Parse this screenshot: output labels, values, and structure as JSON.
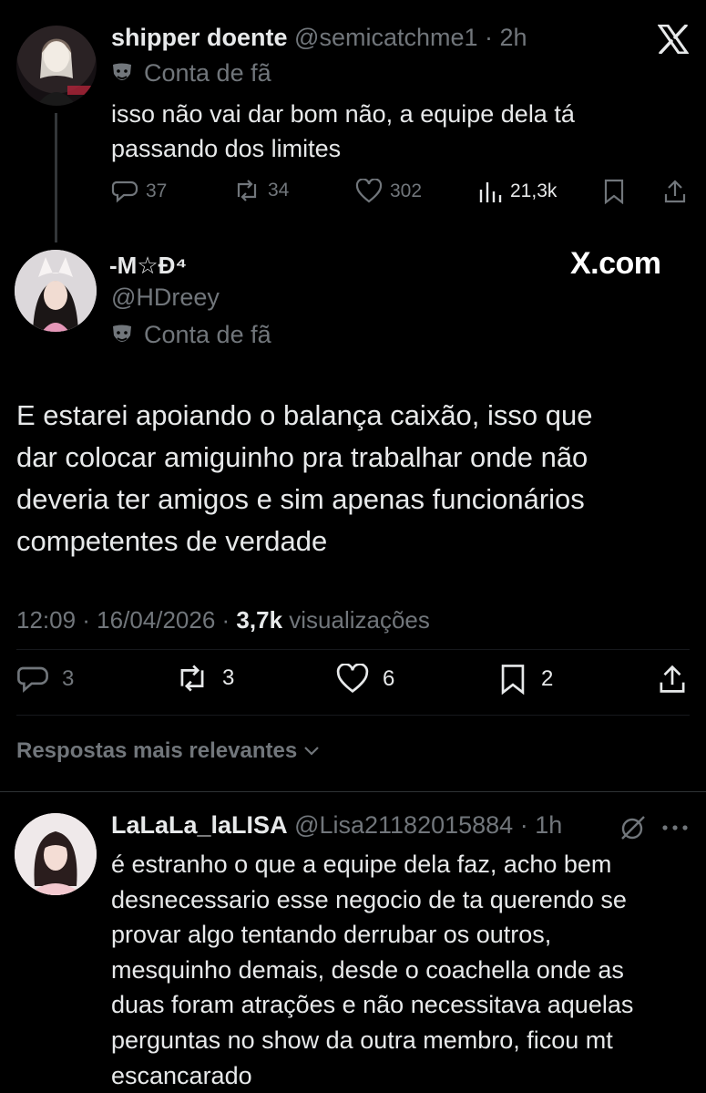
{
  "parent_tweet": {
    "display_name": "shipper doente",
    "handle": "@semicatchme1",
    "time": "· 2h",
    "label": "Conta de fã",
    "text": "isso não vai dar bom não, a equipe dela tá\npassando dos limites",
    "replies": "37",
    "reposts": "34",
    "likes": "302",
    "views": "21,3k"
  },
  "main_tweet": {
    "display_name": "-M☆Ð⁴",
    "handle": "@HDreey",
    "label": "Conta de fã",
    "watermark": "X.com",
    "text": "E estarei apoiando o balança caixão, isso que\ndar colocar amiguinho pra trabalhar onde não\ndeveria ter amigos e sim apenas funcionários\ncompetentes de verdade",
    "timestamp": "12:09 · 16/04/2026 ·",
    "views_count": "3,7k",
    "views_label": "visualizações",
    "replies": "3",
    "reposts": "3",
    "likes": "6",
    "bookmarks": "2"
  },
  "sort": {
    "label": "Respostas mais relevantes"
  },
  "reply_tweet": {
    "display_name": "LaLaLa_laLISA",
    "handle": "@Lisa21182015884",
    "time": "· 1h",
    "text": "é estranho o que a equipe dela faz, acho bem\ndesnecessario esse negocio de ta querendo se\nprovar algo tentando derrubar os outros,\nmesquinho demais, desde o coachella onde as\nduas foram atrações e não necessitava aquelas\nperguntas no show da outra membro, ficou mt\nescancarado"
  },
  "colors": {
    "background": "#000000",
    "text": "#e7e9ea",
    "muted": "#71767b",
    "divider": "#2f3336"
  }
}
